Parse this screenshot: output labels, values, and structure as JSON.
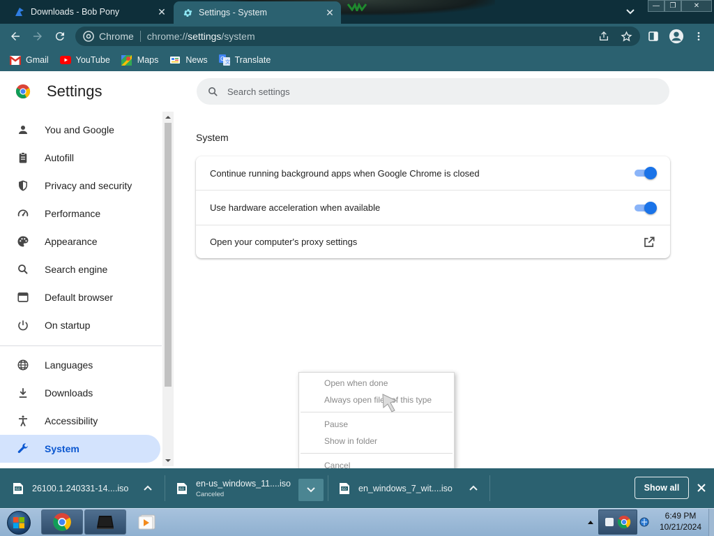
{
  "tabs": [
    {
      "title": "Downloads - Bob Pony",
      "icon": "bob-pony-icon",
      "active": false
    },
    {
      "title": "Settings - System",
      "icon": "gear-icon",
      "active": true
    }
  ],
  "window_controls": {
    "minimize": "—",
    "restore": "❐",
    "close": "✕"
  },
  "omnibox": {
    "site_name": "Chrome",
    "url_scheme": "chrome://",
    "url_host": "settings",
    "url_path": "/system"
  },
  "bookmarks": [
    {
      "label": "Gmail",
      "icon": "gmail-icon"
    },
    {
      "label": "YouTube",
      "icon": "youtube-icon"
    },
    {
      "label": "Maps",
      "icon": "maps-icon"
    },
    {
      "label": "News",
      "icon": "news-icon"
    },
    {
      "label": "Translate",
      "icon": "translate-icon"
    }
  ],
  "settings": {
    "title": "Settings",
    "search_placeholder": "Search settings",
    "nav": [
      {
        "label": "You and Google",
        "icon": "person-icon"
      },
      {
        "label": "Autofill",
        "icon": "clipboard-icon"
      },
      {
        "label": "Privacy and security",
        "icon": "shield-icon"
      },
      {
        "label": "Performance",
        "icon": "speedometer-icon"
      },
      {
        "label": "Appearance",
        "icon": "palette-icon"
      },
      {
        "label": "Search engine",
        "icon": "search-icon"
      },
      {
        "label": "Default browser",
        "icon": "browser-window-icon"
      },
      {
        "label": "On startup",
        "icon": "power-icon"
      },
      {
        "label": "Languages",
        "icon": "globe-icon"
      },
      {
        "label": "Downloads",
        "icon": "download-icon"
      },
      {
        "label": "Accessibility",
        "icon": "accessibility-icon"
      },
      {
        "label": "System",
        "icon": "wrench-icon",
        "active": true
      }
    ],
    "section_title": "System",
    "rows": [
      {
        "label": "Continue running background apps when Google Chrome is closed",
        "control": "toggle",
        "on": true
      },
      {
        "label": "Use hardware acceleration when available",
        "control": "toggle",
        "on": true
      },
      {
        "label": "Open your computer's proxy settings",
        "control": "external-link"
      }
    ]
  },
  "context_menu": {
    "items": [
      {
        "label": "Open when done",
        "enabled": false
      },
      {
        "label": "Always open files of this type",
        "enabled": false
      },
      {
        "label": "Pause",
        "enabled": false
      },
      {
        "label": "Show in folder",
        "enabled": false
      },
      {
        "label": "Cancel",
        "enabled": false
      }
    ]
  },
  "downloads": {
    "items": [
      {
        "name": "26100.1.240331-14....iso",
        "status": ""
      },
      {
        "name": "en-us_windows_11....iso",
        "status": "Canceled"
      },
      {
        "name": "en_windows_7_wit....iso",
        "status": ""
      }
    ],
    "show_all_label": "Show all"
  },
  "taskbar": {
    "clock_time": "6:49 PM",
    "clock_date": "10/21/2024",
    "pinned": [
      "chrome-icon",
      "terminal-icon",
      "media-player-icon"
    ]
  },
  "colors": {
    "frame": "#0e2f3a",
    "toolbar": "#2b6170",
    "accent": "#1a73e8",
    "nav_active_bg": "#d3e3fd",
    "nav_active_text": "#0b57d0"
  }
}
